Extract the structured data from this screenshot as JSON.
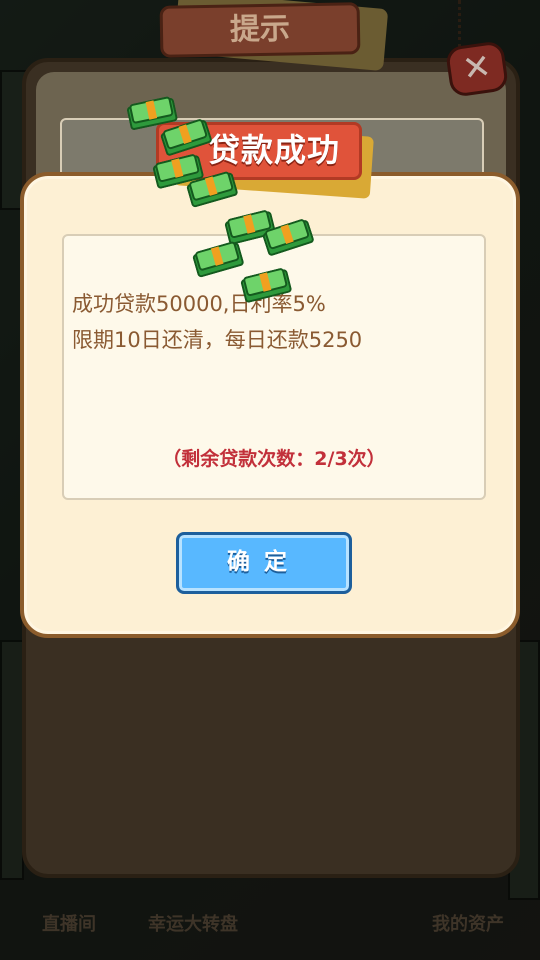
{
  "background": {
    "back_title": "提示",
    "back_bottom_labels": [
      "直播间",
      "幸运大转盘",
      "我的资产"
    ]
  },
  "dialog": {
    "title": "贷款成功",
    "message_line1": "成功贷款50000,日利率5%",
    "message_line2": "限期10日还清，每日还款5250",
    "remaining": "（剩余贷款次数：2/3次）",
    "confirm_label": "确定"
  },
  "colors": {
    "title_ribbon": "#e0533a",
    "confirm_button": "#58b8ff",
    "remaining_text": "#c2303a",
    "message_text": "#8a5a32"
  },
  "icons": [
    "close-icon",
    "money-stack-icon"
  ]
}
